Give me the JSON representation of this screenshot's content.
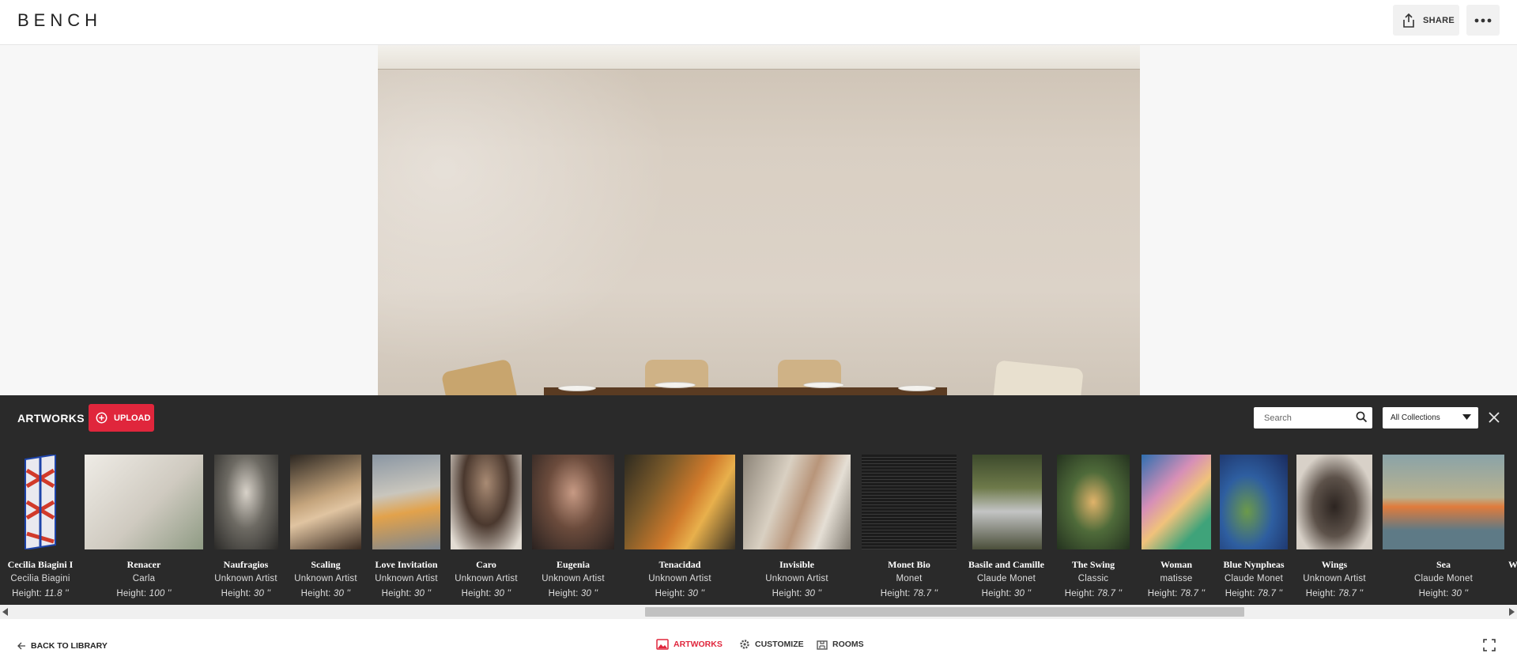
{
  "header": {
    "brand": "BENCH",
    "share_label": "SHARE",
    "icons": {
      "share": "share-icon",
      "more": "more-horizontal-icon"
    }
  },
  "panel": {
    "title": "ARTWORKS",
    "upload_label": "UPLOAD",
    "search_placeholder": "Search",
    "collection_selected": "All Collections"
  },
  "artworks": [
    {
      "title": "Cecilia Biagini I",
      "artist": "Cecilia Biagini",
      "height_label": "Height:",
      "height_value": "11.8 ''"
    },
    {
      "title": "Renacer",
      "artist": "Carla",
      "height_label": "Height:",
      "height_value": "100 ''"
    },
    {
      "title": "Naufragios",
      "artist": "Unknown Artist",
      "height_label": "Height:",
      "height_value": "30 ''"
    },
    {
      "title": "Scaling",
      "artist": "Unknown Artist",
      "height_label": "Height:",
      "height_value": "30 ''"
    },
    {
      "title": "Love Invitation",
      "artist": "Unknown Artist",
      "height_label": "Height:",
      "height_value": "30 ''"
    },
    {
      "title": "Caro",
      "artist": "Unknown Artist",
      "height_label": "Height:",
      "height_value": "30 ''"
    },
    {
      "title": "Eugenia",
      "artist": "Unknown Artist",
      "height_label": "Height:",
      "height_value": "30 ''"
    },
    {
      "title": "Tenacidad",
      "artist": "Unknown Artist",
      "height_label": "Height:",
      "height_value": "30 ''"
    },
    {
      "title": "Invisible",
      "artist": "Unknown Artist",
      "height_label": "Height:",
      "height_value": "30 ''"
    },
    {
      "title": "Monet Bio",
      "artist": "Monet",
      "height_label": "Height:",
      "height_value": "78.7 ''"
    },
    {
      "title": "Basile and Camille",
      "artist": "Claude Monet",
      "height_label": "Height:",
      "height_value": "30 ''"
    },
    {
      "title": "The Swing",
      "artist": "Classic",
      "height_label": "Height:",
      "height_value": "78.7 ''"
    },
    {
      "title": "Woman",
      "artist": "matisse",
      "height_label": "Height:",
      "height_value": "78.7 ''"
    },
    {
      "title": "Blue Nynpheas",
      "artist": "Claude Monet",
      "height_label": "Height:",
      "height_value": "78.7 ''"
    },
    {
      "title": "Wings",
      "artist": "Unknown Artist",
      "height_label": "Height:",
      "height_value": "78.7 ''"
    },
    {
      "title": "Sea",
      "artist": "Claude Monet",
      "height_label": "Height:",
      "height_value": "30 ''"
    }
  ],
  "artwork_overflow": {
    "title": "W"
  },
  "bottombar": {
    "back_label": "BACK TO LIBRARY",
    "tabs": [
      {
        "label": "ARTWORKS",
        "icon": "artworks-icon",
        "active": true
      },
      {
        "label": "CUSTOMIZE",
        "icon": "gear-icon",
        "active": false
      },
      {
        "label": "ROOMS",
        "icon": "rooms-icon",
        "active": false
      }
    ]
  },
  "colors": {
    "accent": "#e0263c",
    "panel_bg": "#1a1a1a"
  }
}
